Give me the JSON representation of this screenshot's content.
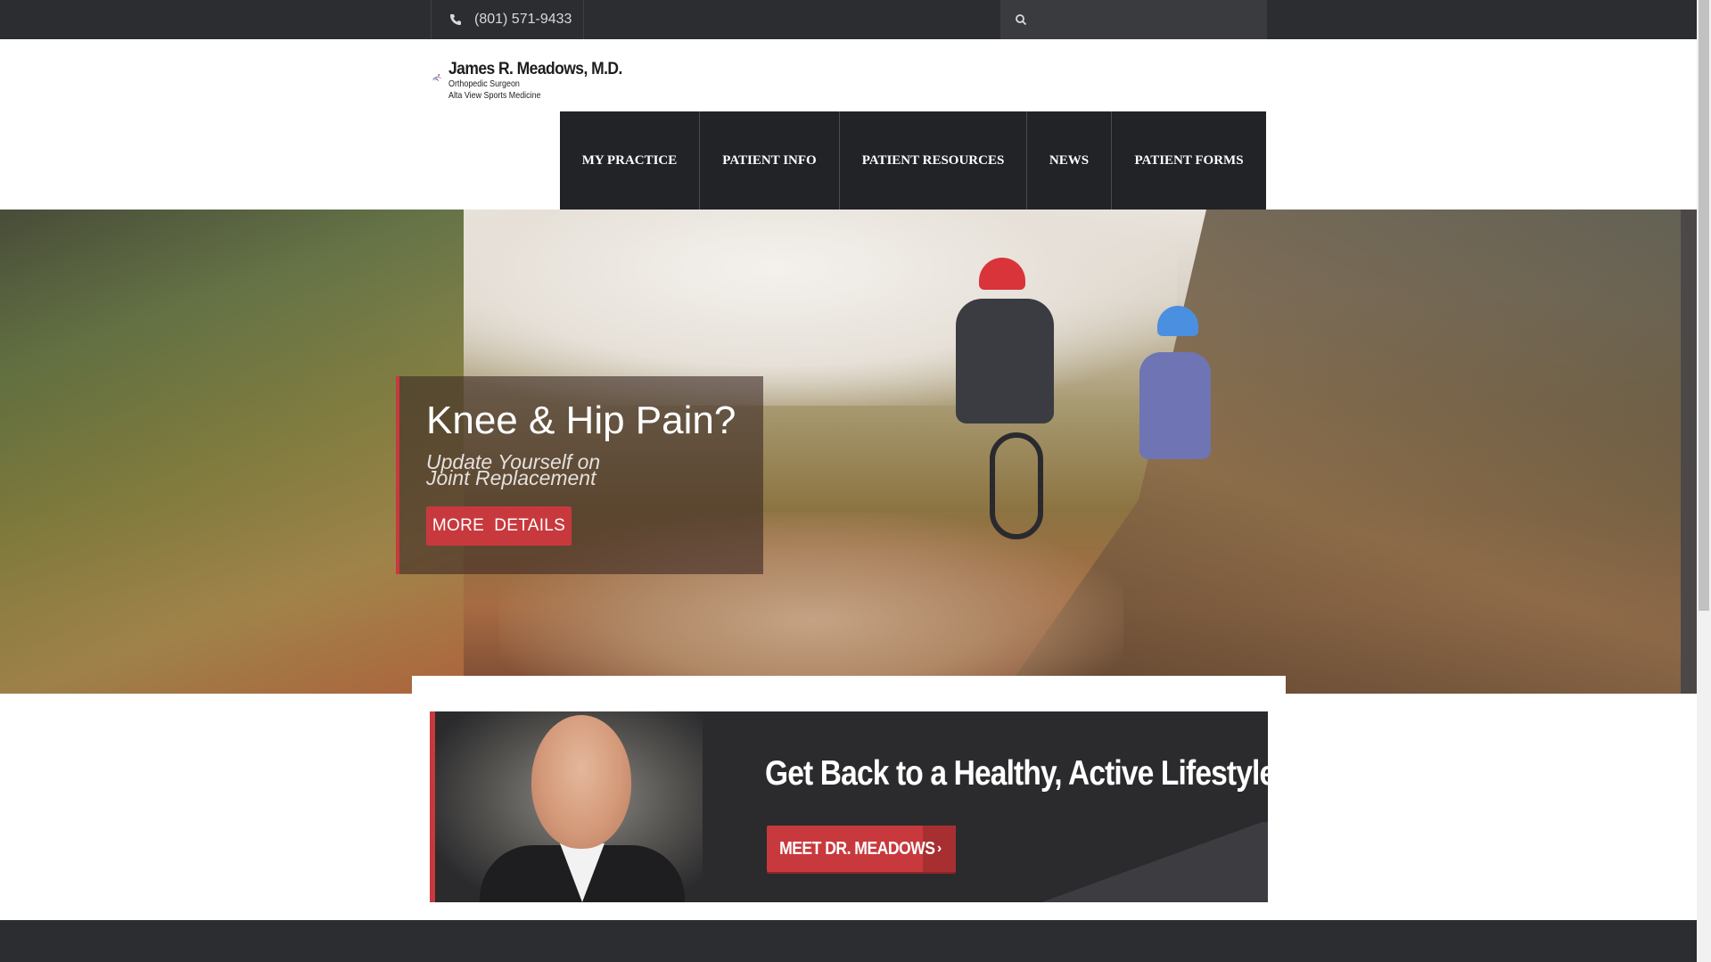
{
  "topbar": {
    "phone": "(801) 571-9433",
    "search_placeholder": ""
  },
  "logo": {
    "name": "James R. Meadows, M.D.",
    "line1": "Orthopedic Surgeon",
    "line2": "Alta View Sports Medicine"
  },
  "nav": {
    "items": [
      "MY PRACTICE",
      "PATIENT INFO",
      "PATIENT RESOURCES",
      "NEWS",
      "PATIENT FORMS"
    ]
  },
  "hero": {
    "title": "Knee & Hip Pain?",
    "subtitle_line1": "Update Yourself on",
    "subtitle_line2": "Joint Replacement",
    "button": "MORE  DETAILS"
  },
  "feature": {
    "title": "Get Back to a Healthy, Active Lifestyle",
    "button": "MEET DR. MEADOWS",
    "button_arrow": "›"
  },
  "colors": {
    "accent": "#c8393d",
    "dark": "#2c2d30",
    "nav_bg": "#222326"
  }
}
